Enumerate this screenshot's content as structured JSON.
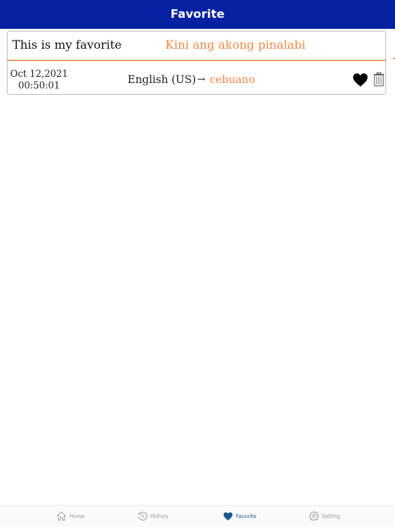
{
  "header": {
    "title": "Favorite"
  },
  "favorites": [
    {
      "source_text": "This is my favorite",
      "translated_text": "Kini ang akong pinalabi",
      "date": "Oct 12,2021",
      "time": "00:50:01",
      "source_lang": "English (US)",
      "arrow": "→",
      "target_lang": "cebuano"
    }
  ],
  "tabbar": {
    "items": [
      {
        "label": "Home",
        "icon": "home-icon"
      },
      {
        "label": "History",
        "icon": "history-icon"
      },
      {
        "label": "Favorite",
        "icon": "heart-icon"
      },
      {
        "label": "Setting",
        "icon": "gear-icon"
      }
    ],
    "active": "Favorite"
  },
  "colors": {
    "header_bg": "#0520a0",
    "accent": "#ee8a48",
    "active_tab": "#1a5a8c",
    "inactive_tab": "#9a9a9a"
  }
}
